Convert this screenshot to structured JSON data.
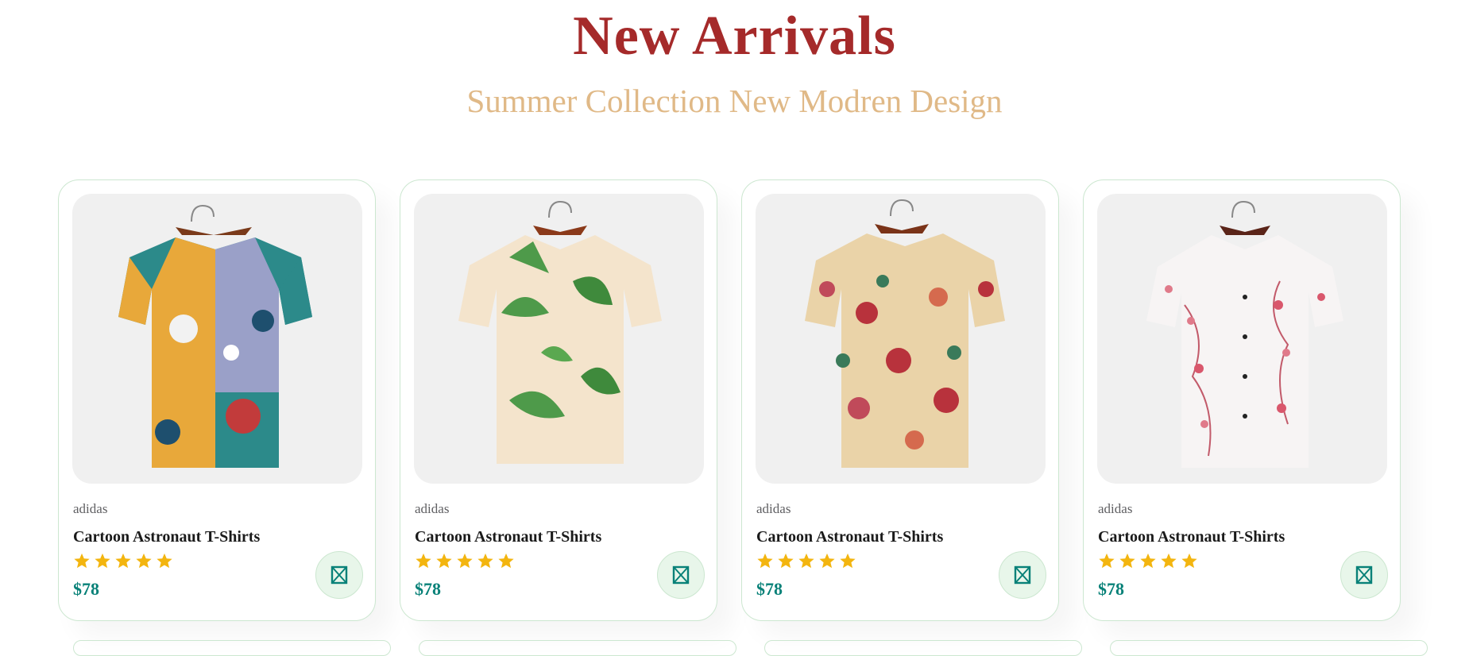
{
  "section": {
    "title": "New Arrivals",
    "subtitle": "Summer Collection New Modren Design"
  },
  "colors": {
    "title": "#a52a2a",
    "subtitle": "#e0b987",
    "price": "#088178",
    "star": "#f3b50f",
    "card_border": "#cce7d0",
    "cart_bg": "#e8f6ea"
  },
  "products": [
    {
      "brand": "adidas",
      "name": "Cartoon Astronaut T-Shirts",
      "rating": 5,
      "price": "$78",
      "image_icon": "multicolor-abstract-print-shirt",
      "cart_icon": "cart-icon"
    },
    {
      "brand": "adidas",
      "name": "Cartoon Astronaut T-Shirts",
      "rating": 5,
      "price": "$78",
      "image_icon": "green-leaf-print-shirt",
      "cart_icon": "cart-icon"
    },
    {
      "brand": "adidas",
      "name": "Cartoon Astronaut T-Shirts",
      "rating": 5,
      "price": "$78",
      "image_icon": "floral-rose-print-shirt",
      "cart_icon": "cart-icon"
    },
    {
      "brand": "adidas",
      "name": "Cartoon Astronaut T-Shirts",
      "rating": 5,
      "price": "$78",
      "image_icon": "pink-blossom-print-shirt",
      "cart_icon": "cart-icon"
    }
  ]
}
